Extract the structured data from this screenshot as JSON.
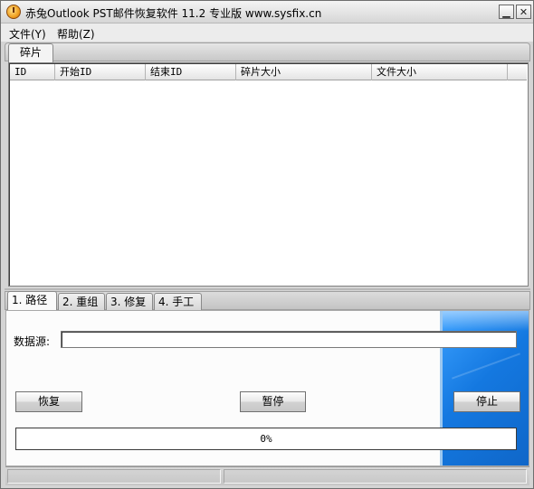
{
  "window": {
    "title": "赤兔Outlook PST邮件恢复软件 11.2 专业版 www.sysfix.cn",
    "icon": "app-logo-icon",
    "minimize_icon": "minimize-icon",
    "close_icon": "close-icon"
  },
  "menu": {
    "file": "文件(Y)",
    "help": "帮助(Z)"
  },
  "top_tabs": [
    {
      "label": "碎片",
      "active": true
    }
  ],
  "fragments_table": {
    "columns": [
      "ID",
      "开始ID",
      "结束ID",
      "碎片大小",
      "文件大小"
    ],
    "rows": []
  },
  "bottom_tabs": [
    {
      "label": "1. 路径",
      "active": true
    },
    {
      "label": "2. 重组",
      "active": false
    },
    {
      "label": "3. 修复",
      "active": false
    },
    {
      "label": "4. 手工",
      "active": false
    }
  ],
  "path_panel": {
    "source_label": "数据源:",
    "source_value": "",
    "buttons": {
      "recover": "恢复",
      "pause": "暂停",
      "stop": "停止"
    },
    "progress": {
      "value_percent": 0,
      "text": "0%"
    },
    "accent_color": "#1478e0"
  },
  "statusbar": {
    "pane1": "",
    "pane2": ""
  }
}
